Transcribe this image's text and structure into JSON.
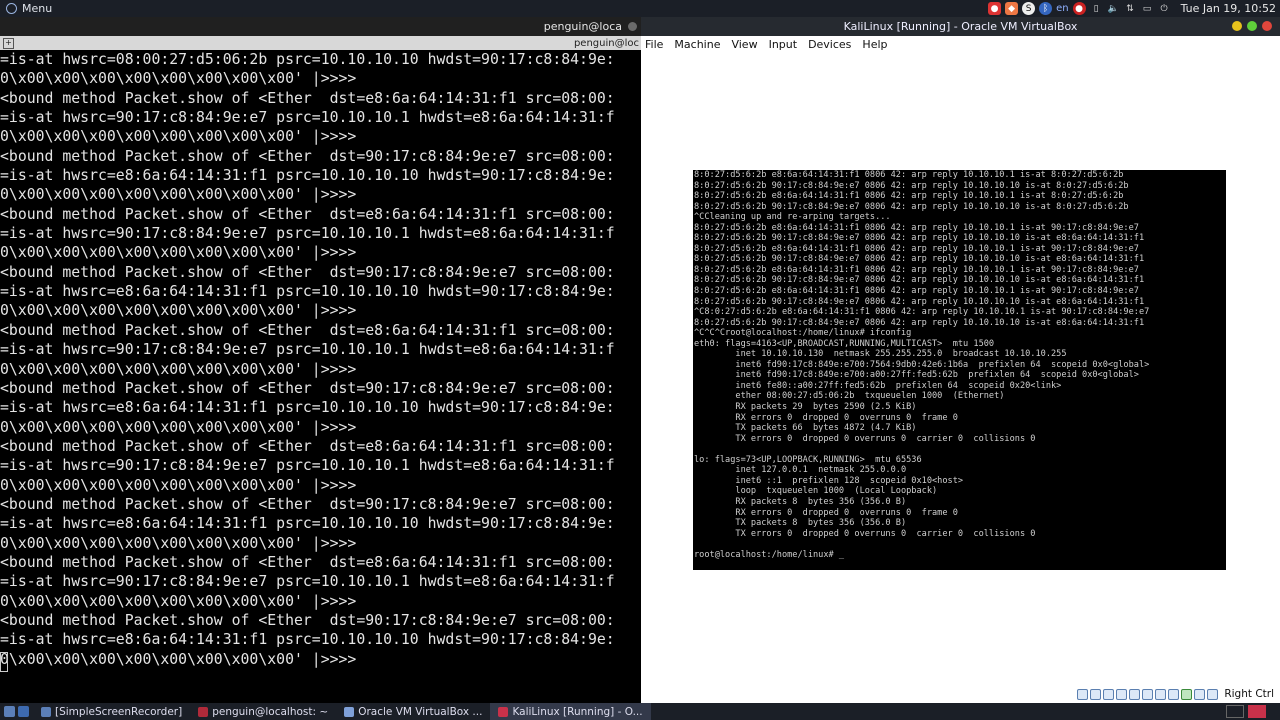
{
  "top_panel": {
    "menu_label": "Menu",
    "lang": "en",
    "clock": "Tue Jan 19, 10:52"
  },
  "terminal": {
    "title": "penguin@loca",
    "tab_label": "penguin@loc",
    "lines": [
      "=is-at hwsrc=08:00:27:d5:06:2b psrc=10.10.10.10 hwdst=90:17:c8:84:9e:",
      "0\\x00\\x00\\x00\\x00\\x00\\x00\\x00\\x00' |>>>>",
      "<bound method Packet.show of <Ether  dst=e8:6a:64:14:31:f1 src=08:00:",
      "=is-at hwsrc=90:17:c8:84:9e:e7 psrc=10.10.10.1 hwdst=e8:6a:64:14:31:f",
      "0\\x00\\x00\\x00\\x00\\x00\\x00\\x00\\x00' |>>>>",
      "<bound method Packet.show of <Ether  dst=90:17:c8:84:9e:e7 src=08:00:",
      "=is-at hwsrc=e8:6a:64:14:31:f1 psrc=10.10.10.10 hwdst=90:17:c8:84:9e:",
      "0\\x00\\x00\\x00\\x00\\x00\\x00\\x00\\x00' |>>>>",
      "<bound method Packet.show of <Ether  dst=e8:6a:64:14:31:f1 src=08:00:",
      "=is-at hwsrc=90:17:c8:84:9e:e7 psrc=10.10.10.1 hwdst=e8:6a:64:14:31:f",
      "0\\x00\\x00\\x00\\x00\\x00\\x00\\x00\\x00' |>>>>",
      "<bound method Packet.show of <Ether  dst=90:17:c8:84:9e:e7 src=08:00:",
      "=is-at hwsrc=e8:6a:64:14:31:f1 psrc=10.10.10.10 hwdst=90:17:c8:84:9e:",
      "0\\x00\\x00\\x00\\x00\\x00\\x00\\x00\\x00' |>>>>",
      "<bound method Packet.show of <Ether  dst=e8:6a:64:14:31:f1 src=08:00:",
      "=is-at hwsrc=90:17:c8:84:9e:e7 psrc=10.10.10.1 hwdst=e8:6a:64:14:31:f",
      "0\\x00\\x00\\x00\\x00\\x00\\x00\\x00\\x00' |>>>>",
      "<bound method Packet.show of <Ether  dst=90:17:c8:84:9e:e7 src=08:00:",
      "=is-at hwsrc=e8:6a:64:14:31:f1 psrc=10.10.10.10 hwdst=90:17:c8:84:9e:",
      "0\\x00\\x00\\x00\\x00\\x00\\x00\\x00\\x00' |>>>>",
      "<bound method Packet.show of <Ether  dst=e8:6a:64:14:31:f1 src=08:00:",
      "=is-at hwsrc=90:17:c8:84:9e:e7 psrc=10.10.10.1 hwdst=e8:6a:64:14:31:f",
      "0\\x00\\x00\\x00\\x00\\x00\\x00\\x00\\x00' |>>>>",
      "<bound method Packet.show of <Ether  dst=90:17:c8:84:9e:e7 src=08:00:",
      "=is-at hwsrc=e8:6a:64:14:31:f1 psrc=10.10.10.10 hwdst=90:17:c8:84:9e:",
      "0\\x00\\x00\\x00\\x00\\x00\\x00\\x00\\x00' |>>>>",
      "<bound method Packet.show of <Ether  dst=e8:6a:64:14:31:f1 src=08:00:",
      "=is-at hwsrc=90:17:c8:84:9e:e7 psrc=10.10.10.1 hwdst=e8:6a:64:14:31:f",
      "0\\x00\\x00\\x00\\x00\\x00\\x00\\x00\\x00' |>>>>",
      "<bound method Packet.show of <Ether  dst=90:17:c8:84:9e:e7 src=08:00:",
      "=is-at hwsrc=e8:6a:64:14:31:f1 psrc=10.10.10.10 hwdst=90:17:c8:84:9e:",
      "0\\x00\\x00\\x00\\x00\\x00\\x00\\x00\\x00' |>>>>"
    ]
  },
  "virtualbox": {
    "title": "KaliLinux [Running] - Oracle VM VirtualBox",
    "menu": [
      "File",
      "Machine",
      "View",
      "Input",
      "Devices",
      "Help"
    ],
    "host_key": "Right Ctrl",
    "console_lines": [
      "8:0:27:d5:6:2b e8:6a:64:14:31:f1 0806 42: arp reply 10.10.10.1 is-at 8:0:27:d5:6:2b",
      "8:0:27:d5:6:2b 90:17:c8:84:9e:e7 0806 42: arp reply 10.10.10.10 is-at 8:0:27:d5:6:2b",
      "8:0:27:d5:6:2b e8:6a:64:14:31:f1 0806 42: arp reply 10.10.10.1 is-at 8:0:27:d5:6:2b",
      "8:0:27:d5:6:2b 90:17:c8:84:9e:e7 0806 42: arp reply 10.10.10.10 is-at 8:0:27:d5:6:2b",
      "^CCleaning up and re-arping targets...",
      "8:0:27:d5:6:2b e8:6a:64:14:31:f1 0806 42: arp reply 10.10.10.1 is-at 90:17:c8:84:9e:e7",
      "8:0:27:d5:6:2b 90:17:c8:84:9e:e7 0806 42: arp reply 10.10.10.10 is-at e8:6a:64:14:31:f1",
      "8:0:27:d5:6:2b e8:6a:64:14:31:f1 0806 42: arp reply 10.10.10.1 is-at 90:17:c8:84:9e:e7",
      "8:0:27:d5:6:2b 90:17:c8:84:9e:e7 0806 42: arp reply 10.10.10.10 is-at e8:6a:64:14:31:f1",
      "8:0:27:d5:6:2b e8:6a:64:14:31:f1 0806 42: arp reply 10.10.10.1 is-at 90:17:c8:84:9e:e7",
      "8:0:27:d5:6:2b 90:17:c8:84:9e:e7 0806 42: arp reply 10.10.10.10 is-at e8:6a:64:14:31:f1",
      "8:0:27:d5:6:2b e8:6a:64:14:31:f1 0806 42: arp reply 10.10.10.1 is-at 90:17:c8:84:9e:e7",
      "8:0:27:d5:6:2b 90:17:c8:84:9e:e7 0806 42: arp reply 10.10.10.10 is-at e8:6a:64:14:31:f1",
      "^C8:0:27:d5:6:2b e8:6a:64:14:31:f1 0806 42: arp reply 10.10.10.1 is-at 90:17:c8:84:9e:e7",
      "8:0:27:d5:6:2b 90:17:c8:84:9e:e7 0806 42: arp reply 10.10.10.10 is-at e8:6a:64:14:31:f1",
      "^C^C^Croot@localhost:/home/linux# ifconfig",
      "eth0: flags=4163<UP,BROADCAST,RUNNING,MULTICAST>  mtu 1500",
      "        inet 10.10.10.130  netmask 255.255.255.0  broadcast 10.10.10.255",
      "        inet6 fd90:17c8:849e:e700:7564:9db0:42e6:1b6a  prefixlen 64  scopeid 0x0<global>",
      "        inet6 fd90:17c8:849e:e700:a00:27ff:fed5:62b  prefixlen 64  scopeid 0x0<global>",
      "        inet6 fe80::a00:27ff:fed5:62b  prefixlen 64  scopeid 0x20<link>",
      "        ether 08:00:27:d5:06:2b  txqueuelen 1000  (Ethernet)",
      "        RX packets 29  bytes 2590 (2.5 KiB)",
      "        RX errors 0  dropped 0  overruns 0  frame 0",
      "        TX packets 66  bytes 4872 (4.7 KiB)",
      "        TX errors 0  dropped 0 overruns 0  carrier 0  collisions 0",
      "",
      "lo: flags=73<UP,LOOPBACK,RUNNING>  mtu 65536",
      "        inet 127.0.0.1  netmask 255.0.0.0",
      "        inet6 ::1  prefixlen 128  scopeid 0x10<host>",
      "        loop  txqueuelen 1000  (Local Loopback)",
      "        RX packets 8  bytes 356 (356.0 B)",
      "        RX errors 0  dropped 0  overruns 0  frame 0",
      "        TX packets 8  bytes 356 (356.0 B)",
      "        TX errors 0  dropped 0 overruns 0  carrier 0  collisions 0",
      "",
      "root@localhost:/home/linux# _"
    ]
  },
  "taskbar": {
    "items": [
      {
        "label": "[SimpleScreenRecorder]",
        "icon": "recorder-icon",
        "color": "#5b7fb8"
      },
      {
        "label": "penguin@localhost: ~",
        "icon": "terminal-icon",
        "color": "#b02a3a"
      },
      {
        "label": "Oracle VM VirtualBox ...",
        "icon": "virtualbox-icon",
        "color": "#7fa0d8"
      },
      {
        "label": "KaliLinux [Running] - O...",
        "icon": "vm-icon",
        "color": "#c8314a"
      }
    ]
  },
  "colors": {
    "panel_bg": "#1b1f27",
    "accent_red": "#c8314a",
    "terminal_text": "#e4e4e4"
  }
}
